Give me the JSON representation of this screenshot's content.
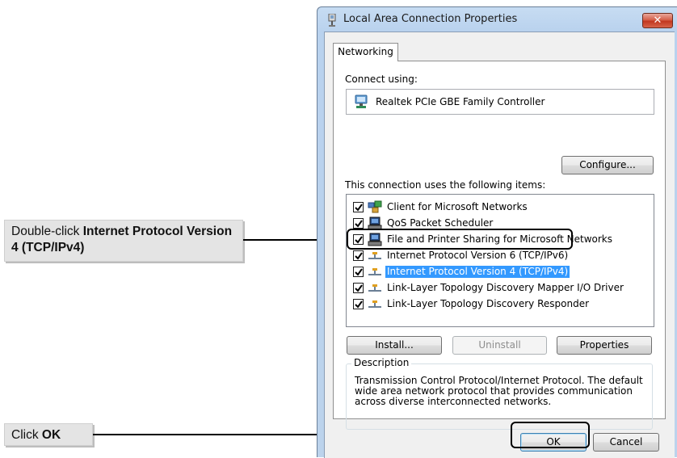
{
  "callouts": {
    "protocol": {
      "prefix": "Double-click ",
      "bold": "Internet Protocol Version 4 (TCP/IPv4)"
    },
    "ok": {
      "prefix": "Click ",
      "bold": "OK"
    }
  },
  "dialog": {
    "title": "Local Area Connection Properties",
    "close_glyph": "✕",
    "tab": "Networking",
    "connect_using_label": "Connect using:",
    "adapter_name": "Realtek PCIe GBE Family Controller",
    "configure_label": "Configure...",
    "items_label": "This connection uses the following items:",
    "items": [
      {
        "label": "Client for Microsoft Networks",
        "checked": true,
        "icon": "network-client-icon"
      },
      {
        "label": "QoS Packet Scheduler",
        "checked": true,
        "icon": "computer-icon"
      },
      {
        "label": "File and Printer Sharing for Microsoft Networks",
        "checked": true,
        "icon": "computer-icon"
      },
      {
        "label": "Internet Protocol Version 6 (TCP/IPv6)",
        "checked": true,
        "icon": "protocol-icon"
      },
      {
        "label": "Internet Protocol Version 4 (TCP/IPv4)",
        "checked": true,
        "icon": "protocol-icon",
        "selected": true
      },
      {
        "label": "Link-Layer Topology Discovery Mapper I/O Driver",
        "checked": true,
        "icon": "protocol-icon"
      },
      {
        "label": "Link-Layer Topology Discovery Responder",
        "checked": true,
        "icon": "protocol-icon"
      }
    ],
    "install_label": "Install...",
    "uninstall_label": "Uninstall",
    "properties_label": "Properties",
    "description_legend": "Description",
    "description_text": "Transmission Control Protocol/Internet Protocol. The default wide area network protocol that provides communication across diverse interconnected networks.",
    "ok_label": "OK",
    "cancel_label": "Cancel"
  },
  "colors": {
    "selection": "#3399ff",
    "callout_bg": "#e4e4e4",
    "titlebar": "#b9d2ee",
    "close": "#c2381f"
  }
}
